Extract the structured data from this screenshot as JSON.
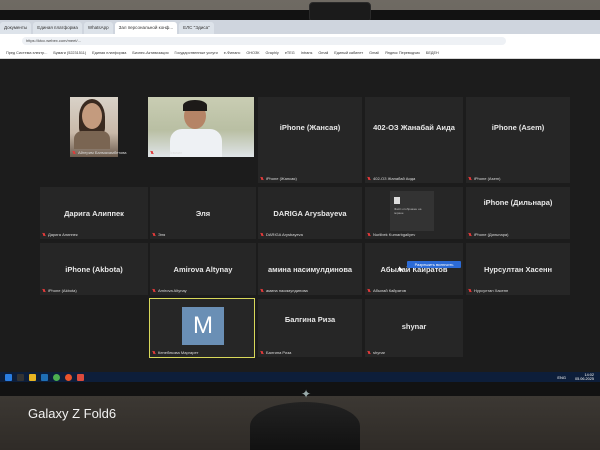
{
  "browser": {
    "tabs": [
      {
        "label": "Документы"
      },
      {
        "label": "Единая платформа"
      },
      {
        "label": "WhatsApp"
      },
      {
        "label": "Зал персональной конф..."
      },
      {
        "label": "ЕЛС \"Эдиса\""
      }
    ],
    "url": "https://ktcc.webex.com/meet/...",
    "bookmarks": [
      "Пред Система электр...",
      "Бумаги (52231511)",
      "Единая платформа",
      "Бизнес-Активизация",
      "Государственные услуги",
      "e-Финанс",
      "ОНОЗК",
      "Graphly",
      "eTEG",
      "Intrans",
      "Gmail",
      "Единый кабинет",
      "Gmail",
      "Яндекс Переводчик",
      "БЕДЕН"
    ]
  },
  "participants": [
    {
      "name": "",
      "label": "Айгерим Балмахамбетова"
    },
    {
      "name": "",
      "label": "Канат Исмаил"
    },
    {
      "name": "iPhone (Жансая)",
      "label": "iPhone (Жансая)"
    },
    {
      "name": "402-ОЗ Жанабай Аида",
      "label": "402-ОЗ Жанабай Аида"
    },
    {
      "name": "iPhone (Asem)",
      "label": "iPhone (Asem)"
    },
    {
      "name": "Дарига Алиппек",
      "label": "Дарига Алиппек"
    },
    {
      "name": "Эля",
      "label": "Эля"
    },
    {
      "name": "DARIGA Arysbayeva",
      "label": "DARIGA Arysbayeva"
    },
    {
      "name": "",
      "label": "Nurlibek Kumarbgaliyev"
    },
    {
      "name": "iPhone (Дильнара)",
      "label": "iPhone (Дильнара)"
    },
    {
      "name": "iPhone (Akbota)",
      "label": "iPhone (Akbota)"
    },
    {
      "name": "Amirova Altynay",
      "label": "Amirova Altynay"
    },
    {
      "name": "амина насимулдинова",
      "label": "амина насимулдинова"
    },
    {
      "name": "Абылай Кайратов",
      "label": "Абылай Кайратов"
    },
    {
      "name": "Нурсултан Хасенн",
      "label": "Нурсултан Хасенн"
    },
    {
      "name": "",
      "label": "Кенебекова Маргарет"
    },
    {
      "name": "Балгина Риза",
      "label": "Балгина Риза"
    },
    {
      "name": "shynar",
      "label": "shynar"
    }
  ],
  "avatar_letter": "M",
  "share_text": "Файл отображен на экране",
  "allow_button": "Разрешить включить",
  "taskbar": {
    "lang": "ENG",
    "time": "14:02",
    "date": "05.06.2025"
  },
  "watermark": "Galaxy Z Fold6",
  "colors": {
    "tile_bg": "#262626",
    "meeting_bg": "#1c1c1c",
    "mute_red": "#e03a3a",
    "highlight": "#d8d85a",
    "button_blue": "#2c6bd6",
    "taskbar": "#0d1e3a"
  }
}
